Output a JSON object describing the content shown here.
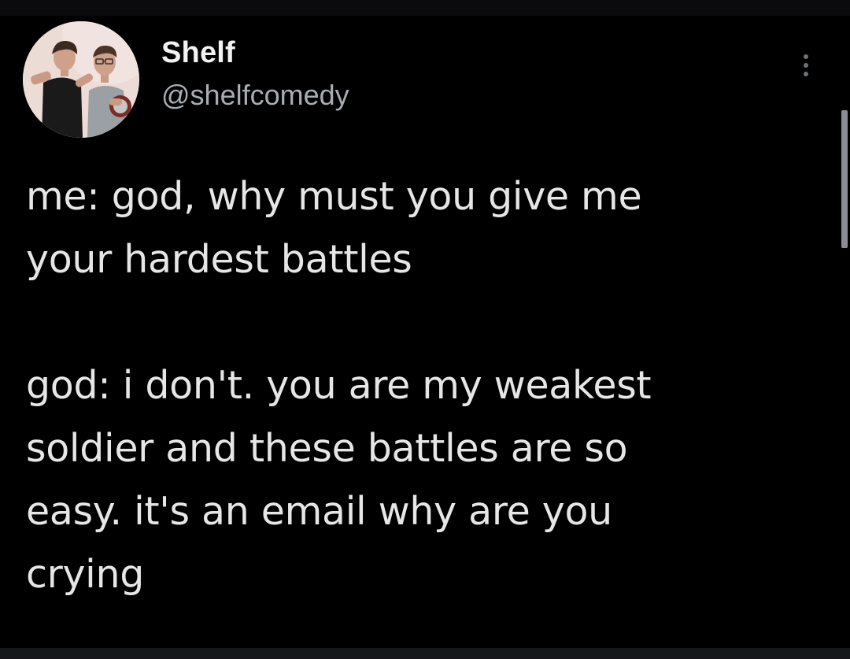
{
  "author": {
    "display_name": "Shelf",
    "handle": "@shelfcomedy"
  },
  "tweet": {
    "paragraph1": [
      "me: god, why must you give me",
      "your hardest battles"
    ],
    "paragraph2": [
      "god: i don't. you are my weakest",
      "soldier and these battles are so",
      "easy. it's an email why are you",
      "crying"
    ]
  },
  "colors": {
    "background": "#000000",
    "text_primary": "#e6e6e6",
    "text_secondary": "#a8adb3",
    "avatar_background": "#e9dcd8"
  },
  "icons": {
    "more": "more-vertical-icon"
  }
}
